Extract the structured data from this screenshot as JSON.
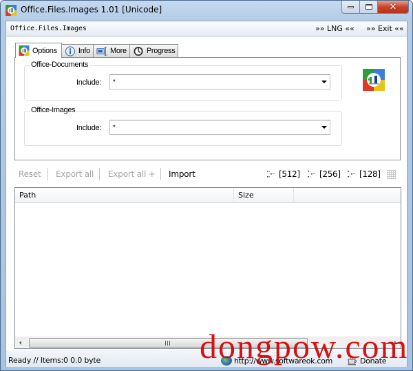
{
  "window": {
    "title": "Office.Files.Images 1.01 [Unicode]",
    "controls": {
      "minimize": "minimize",
      "maximize": "maximize",
      "close": "✕"
    }
  },
  "menubar": {
    "app_label": "Office.Files.Images",
    "lng": "»» LNG ««",
    "exit": "»» Exit ««"
  },
  "tabs": [
    {
      "label": "Options",
      "icon": "app-logo-icon",
      "active": true
    },
    {
      "label": "Info",
      "icon": "info-icon",
      "active": false
    },
    {
      "label": "More",
      "icon": "text-cursor-icon",
      "active": false
    },
    {
      "label": "Progress",
      "icon": "clock-icon",
      "active": false
    }
  ],
  "options": {
    "documents": {
      "legend": "Office-Documents",
      "include_label": "Include:",
      "include_value": "*"
    },
    "images": {
      "legend": "Office-Images",
      "include_label": "Include:",
      "include_value": "*"
    }
  },
  "toolbar": {
    "reset": "Reset",
    "export_all": "Export all",
    "export_all_plus": "Export all +",
    "import": "Import",
    "sizes": [
      "[512]",
      "[256]",
      "[128]"
    ]
  },
  "list": {
    "columns": [
      "Path",
      "Size"
    ],
    "rows": []
  },
  "status": {
    "text": "Ready // Items:0 0.0 byte",
    "website": "http://www.softwareok.com",
    "donate": "Donate"
  },
  "watermark": "dongpow.com",
  "colors": {
    "close_button": "#c8452c",
    "watermark": "#d40000",
    "disabled_text": "#a5a5a5"
  }
}
